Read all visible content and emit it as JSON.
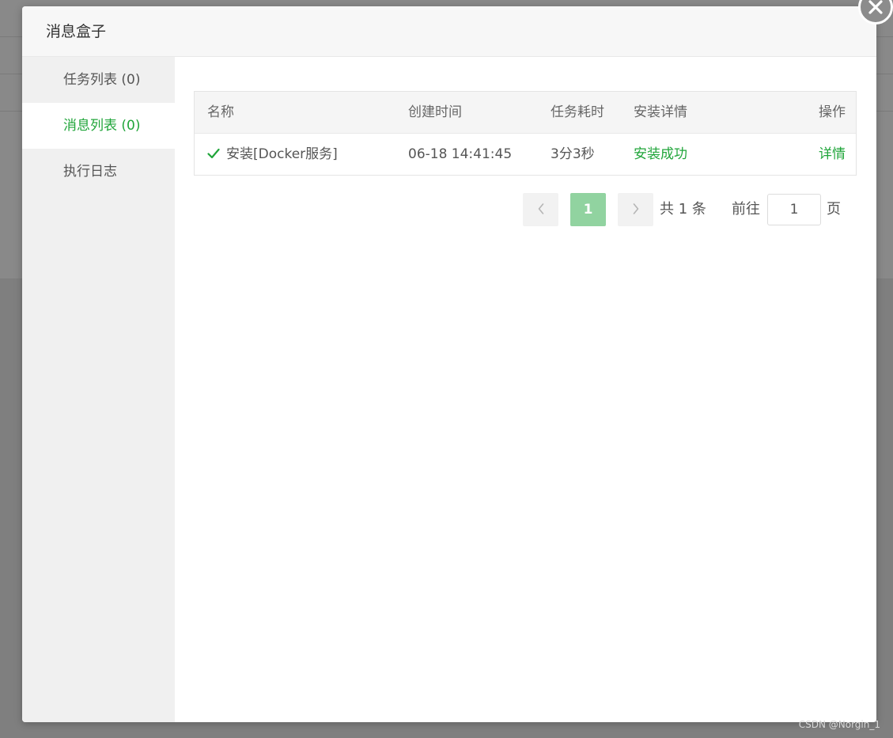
{
  "dialog": {
    "title": "消息盒子"
  },
  "sidebar": {
    "items": [
      {
        "label": "任务列表 (0)",
        "active": false
      },
      {
        "label": "消息列表 (0)",
        "active": true
      },
      {
        "label": "执行日志",
        "active": false
      }
    ]
  },
  "table": {
    "columns": [
      "名称",
      "创建时间",
      "任务耗时",
      "安装详情",
      "操作"
    ],
    "rows": [
      {
        "name": "安装[Docker服务]",
        "created": "06-18 14:41:45",
        "duration": "3分3秒",
        "status": "安装成功",
        "action": "详情"
      }
    ]
  },
  "pagination": {
    "current_page": "1",
    "total_text": "共 1 条",
    "goto_label": "前往",
    "goto_value": "1",
    "page_unit": "页"
  },
  "colors": {
    "accent": "#20a53a",
    "page_active_bg": "#91d3a0"
  },
  "watermark": "CSDN @Norgin_1"
}
